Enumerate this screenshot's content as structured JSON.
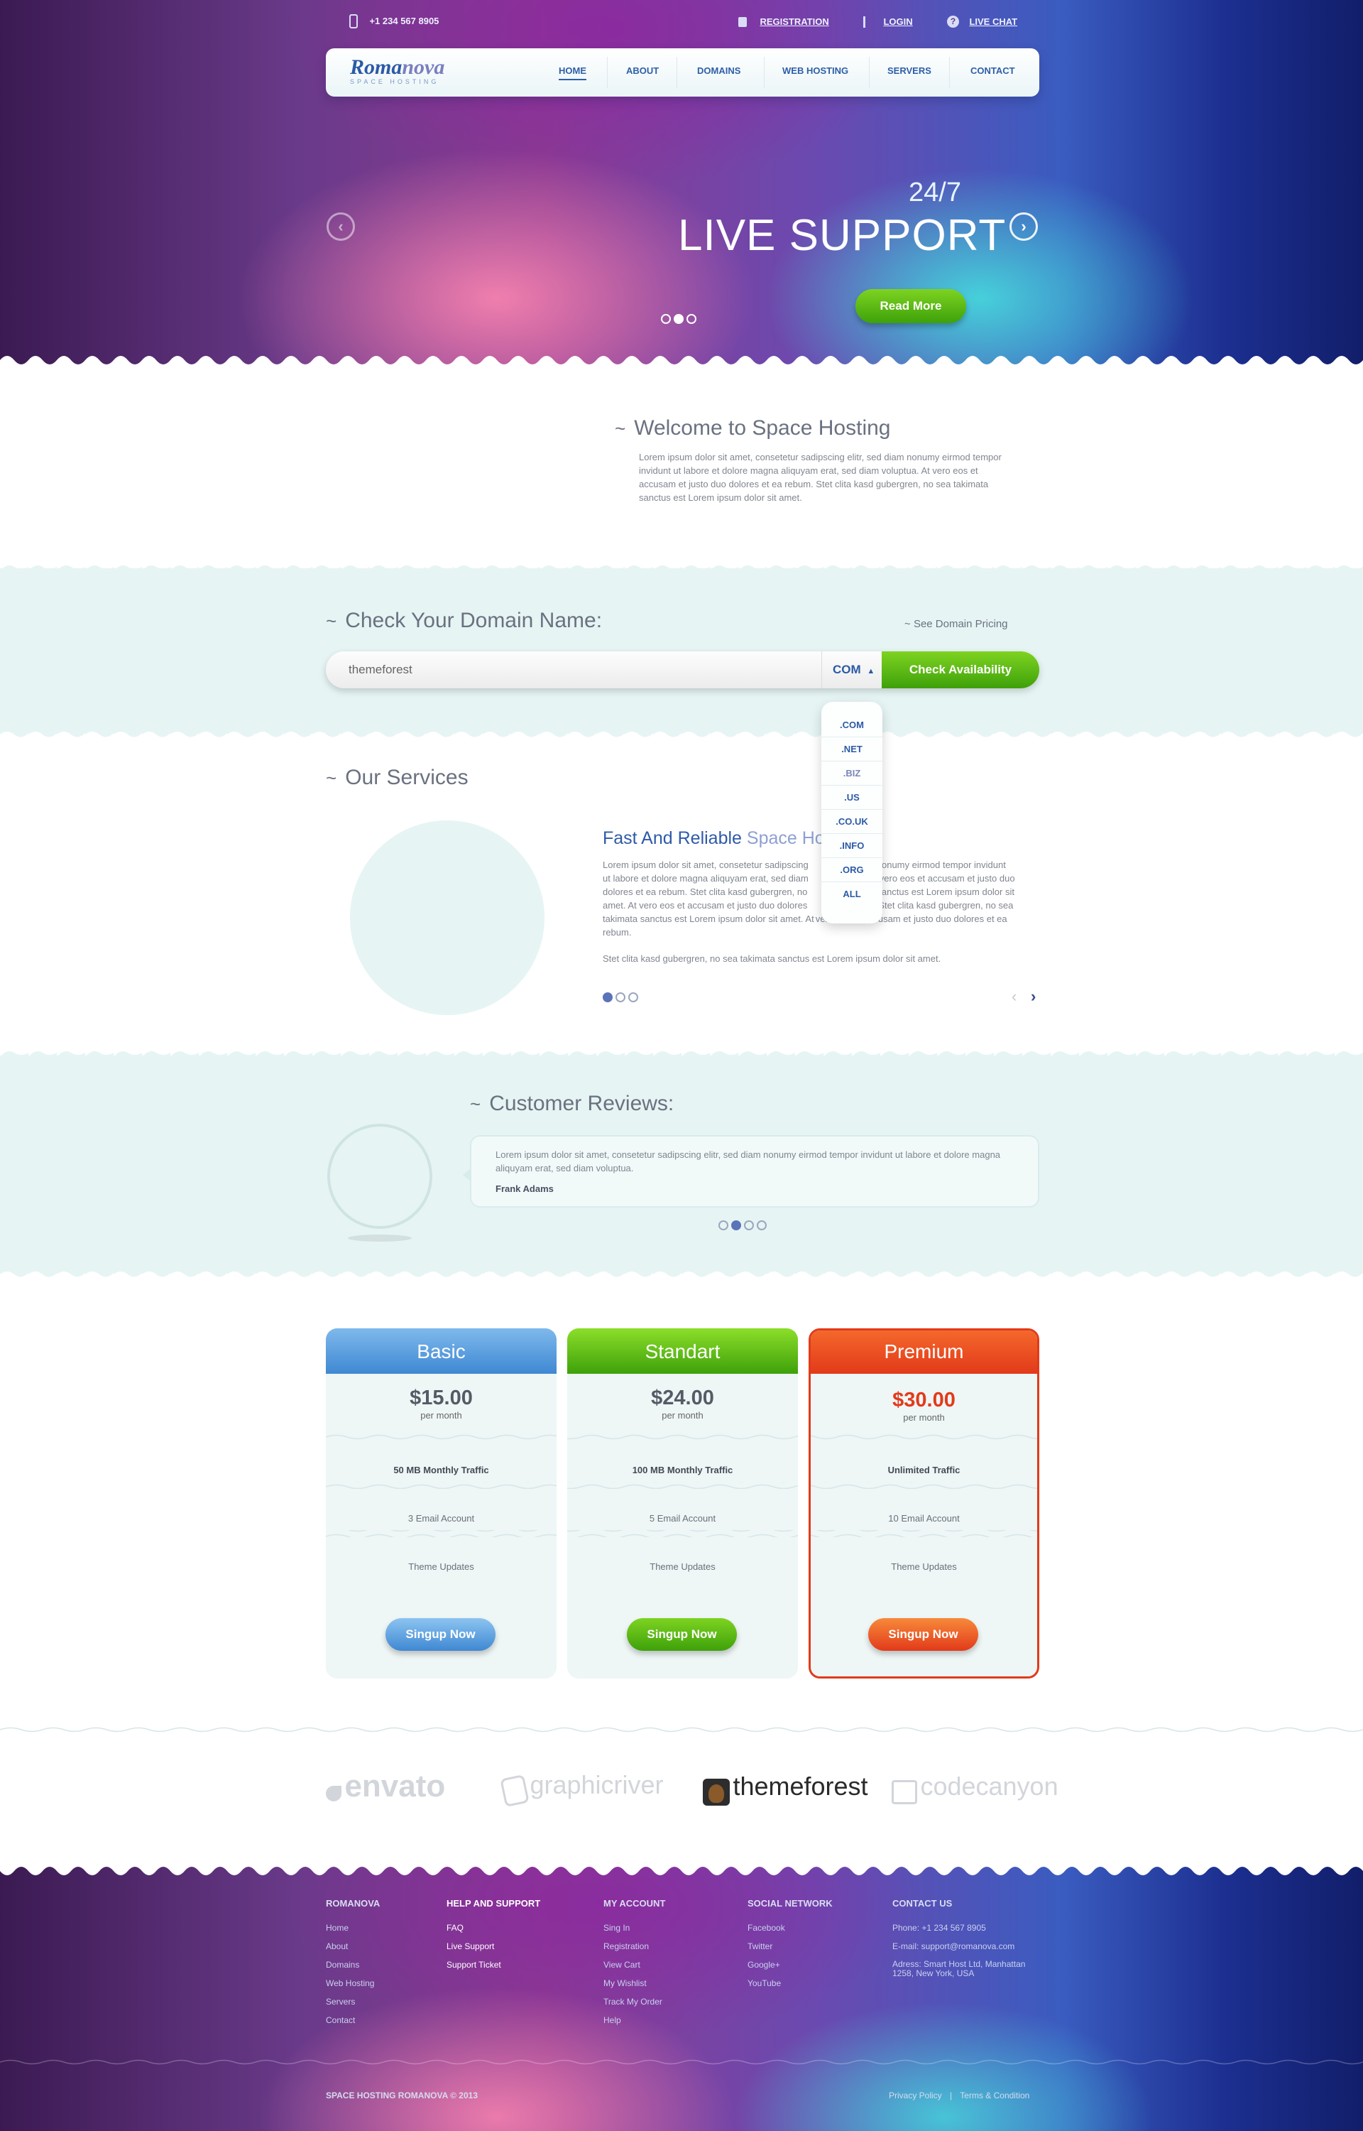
{
  "topbar": {
    "phone": "+1 234 567 8905",
    "registration": "REGISTRATION",
    "login": "LOGIN",
    "live_chat": "LIVE CHAT"
  },
  "logo": {
    "part1": "Roma",
    "part2": "nova",
    "tagline": "SPACE HOSTING"
  },
  "nav": {
    "items": [
      "HOME",
      "ABOUT",
      "DOMAINS",
      "WEB HOSTING",
      "SERVERS",
      "CONTACT"
    ],
    "active": "HOME"
  },
  "hero": {
    "subtitle": "24/7",
    "title": "LIVE SUPPORT",
    "button": "Read More",
    "prev_icon": "chevron-left-icon",
    "next_icon": "chevron-right-icon",
    "slides": 3,
    "active_slide": 2
  },
  "welcome": {
    "title": "Welcome to Space Hosting",
    "text": "Lorem ipsum dolor sit amet, consetetur sadipscing elitr, sed diam nonumy eirmod tempor invidunt ut labore et dolore magna aliquyam erat, sed diam voluptua. At vero eos et accusam et justo duo dolores et ea rebum. Stet clita kasd gubergren, no sea takimata sanctus est Lorem ipsum dolor sit amet."
  },
  "domain": {
    "title": "Check Your Domain Name:",
    "pricing_link": "See Domain Pricing",
    "input_value": "themeforest",
    "tld_selected": "COM",
    "button": "Check Availability",
    "tld_options": [
      ".COM",
      ".NET",
      ".BIZ",
      ".US",
      ".CO.UK",
      ".INFO",
      ".ORG",
      "ALL"
    ]
  },
  "services": {
    "title": "Our Services",
    "heading_part1": "Fast And Reliable ",
    "heading_part2": "Space Ho",
    "para1_lines": [
      "Lorem ipsum dolor sit amet, consetetur sadipscing",
      "ut labore et dolore magna aliquyam erat, sed diam",
      "dolores et ea rebum. Stet clita kasd gubergren, no",
      "amet. At vero eos et accusam et justo duo dolores",
      "takimata sanctus est Lorem ipsum dolor sit amet. At",
      "rebum."
    ],
    "para1_right_lines": [
      "nonumy eirmod tempor invidunt",
      "vero eos et accusam et justo duo",
      "sanctus est Lorem ipsum dolor sit",
      "Stet clita kasd gubergren, no sea",
      "justo duo dolores et ea",
      ""
    ],
    "para1_mid_fragments": [
      "",
      "",
      "",
      "",
      "vero eos et accusam et",
      ""
    ],
    "para2": "Stet clita kasd gubergren, no sea takimata sanctus est Lorem ipsum dolor sit amet.",
    "pager_dots": 3,
    "pager_active": 1
  },
  "reviews": {
    "title": "Customer Reviews:",
    "text": "Lorem ipsum dolor sit amet, consetetur sadipscing elitr, sed diam nonumy eirmod tempor invidunt ut labore et dolore magna aliquyam erat, sed diam voluptua.",
    "author": "Frank Adams",
    "dots": 4,
    "active_dot": 2
  },
  "pricing": [
    {
      "name": "Basic",
      "price": "$15.00",
      "period": "per month",
      "traffic": "50 MB Monthly Traffic",
      "email": "3 Email Account",
      "updates": "Theme Updates",
      "button": "Singup Now",
      "color": "#4e97dc"
    },
    {
      "name": "Standart",
      "price": "$24.00",
      "period": "per month",
      "traffic": "100 MB Monthly Traffic",
      "email": "5 Email Account",
      "updates": "Theme Updates",
      "button": "Singup Now",
      "color": "#4cb813"
    },
    {
      "name": "Premium",
      "price": "$30.00",
      "period": "per month",
      "traffic": "Unlimited Traffic",
      "email": "10 Email Account",
      "updates": "Theme Updates",
      "button": "Singup Now",
      "color": "#e8411c"
    }
  ],
  "partners": [
    "envato",
    "graphicriver",
    "themeforest",
    "codecanyon"
  ],
  "footer": {
    "columns": [
      {
        "heading": "ROMANOVA",
        "links": [
          "Home",
          "About",
          "Domains",
          "Web Hosting",
          "Servers",
          "Contact"
        ]
      },
      {
        "heading": "HELP AND SUPPORT",
        "links": [
          "FAQ",
          "Live Support",
          "Support Ticket"
        ]
      },
      {
        "heading": "MY ACCOUNT",
        "links": [
          "Sing In",
          "Registration",
          "View Cart",
          "My Wishlist",
          "Track My Order",
          "Help"
        ]
      },
      {
        "heading": "SOCIAL NETWORK",
        "links": [
          "Facebook",
          "Twitter",
          "Google+",
          "YouTube"
        ]
      },
      {
        "heading": "CONTACT US",
        "links": [
          "Phone: +1 234 567 8905",
          "E-mail: support@romanova.com",
          "Adress: Smart Host Ltd, Manhattan 1258, New York, USA"
        ]
      }
    ],
    "copyright": "SPACE HOSTING ROMANOVA © 2013",
    "privacy": "Privacy Policy",
    "divider": "|",
    "terms": "Terms & Condition"
  }
}
